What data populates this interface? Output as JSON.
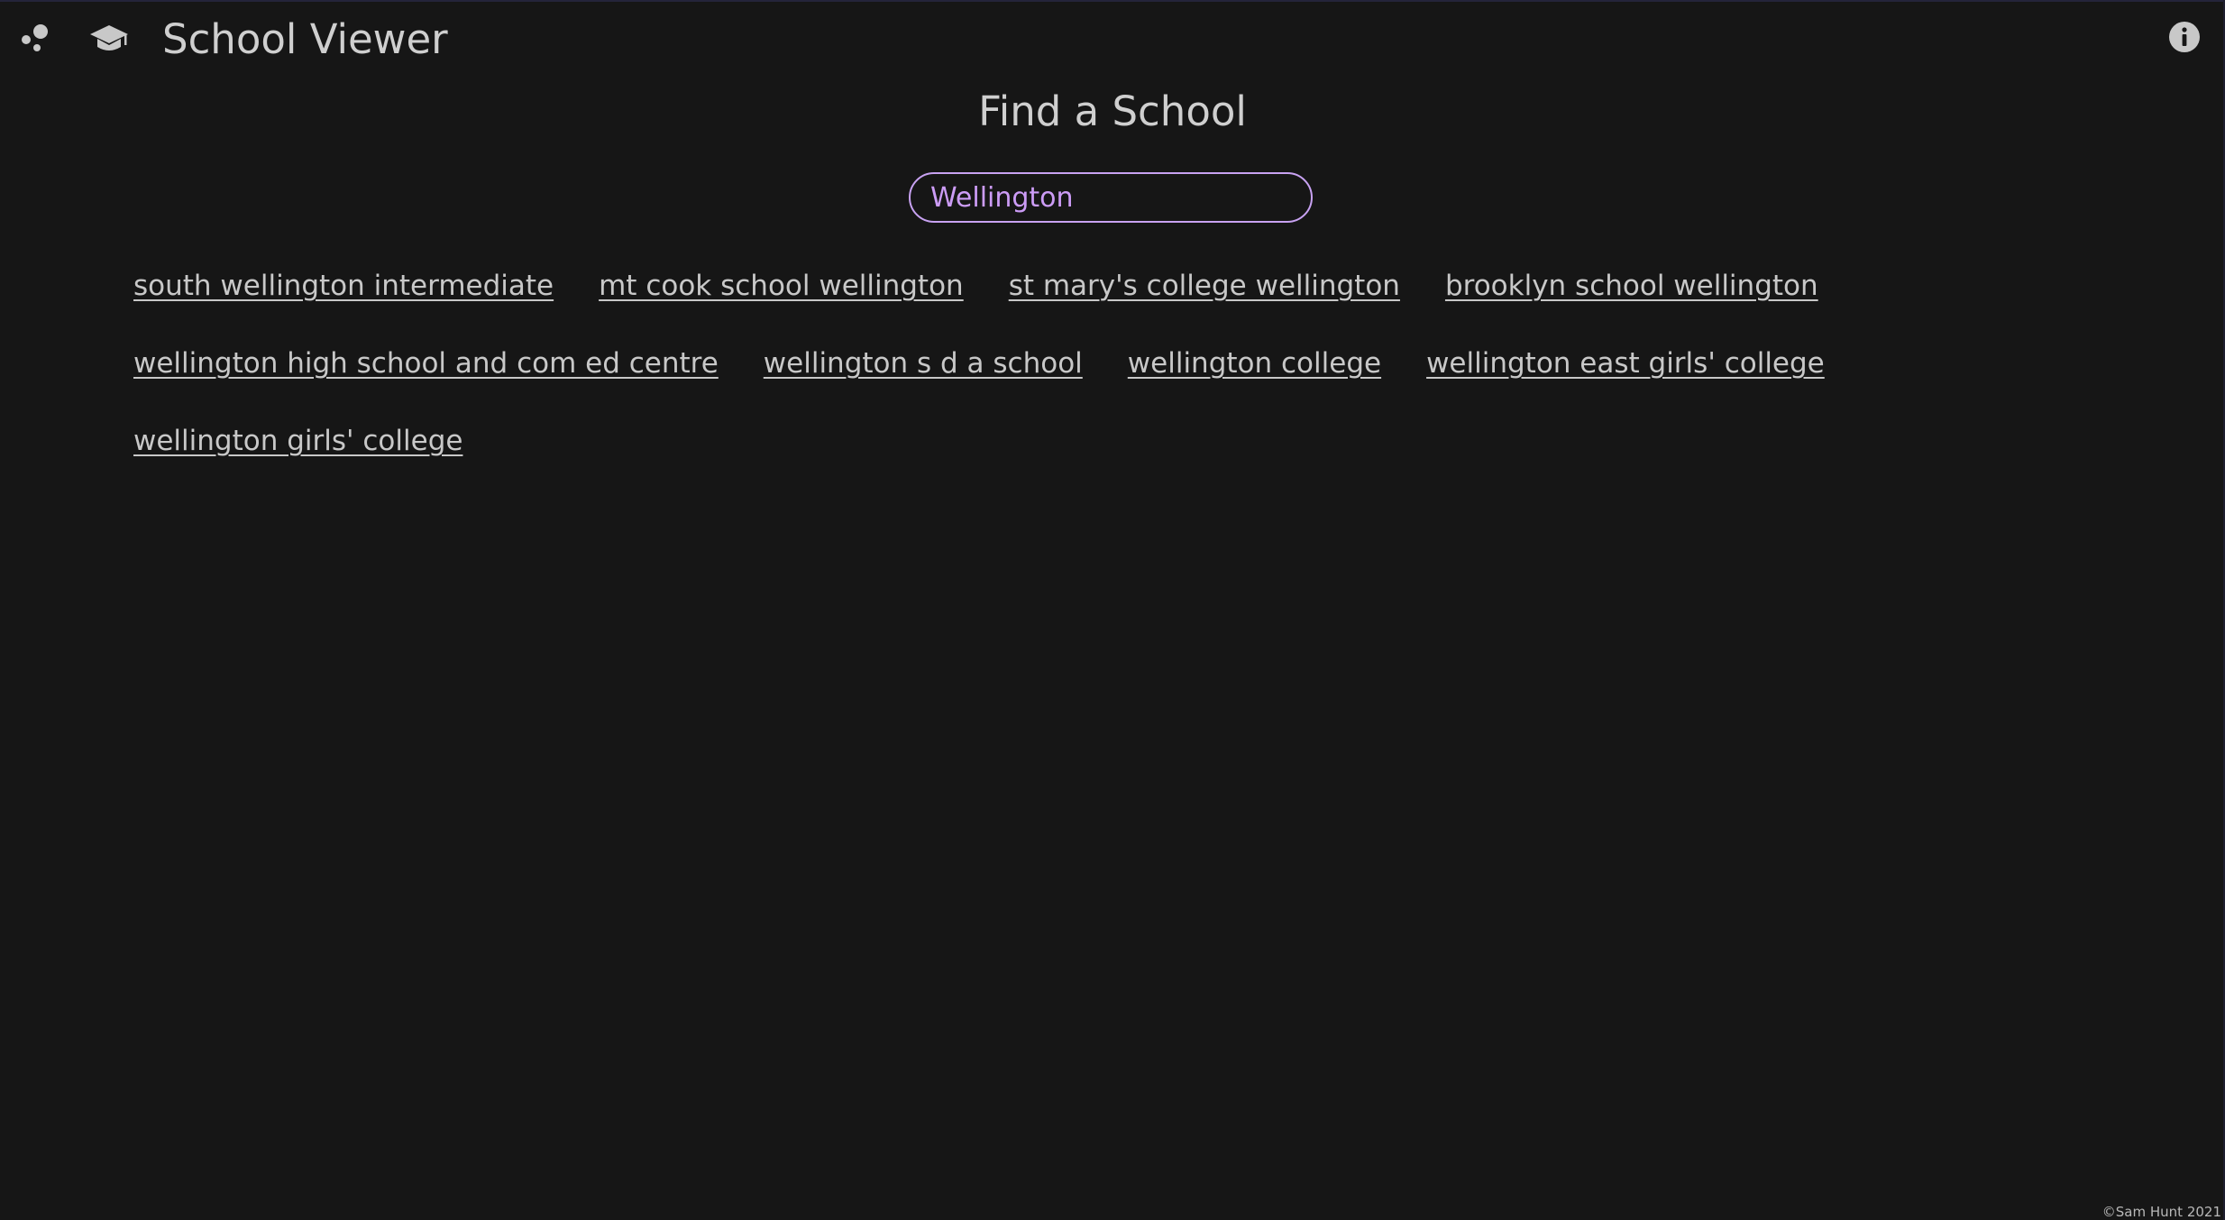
{
  "app": {
    "title": "School Viewer",
    "icons": {
      "menu": "app-logo-icon",
      "brand": "graduation-cap-icon",
      "info": "info-icon"
    }
  },
  "page": {
    "heading": "Find a School"
  },
  "search": {
    "value": "Wellington",
    "placeholder": ""
  },
  "results": [
    "south wellington intermediate",
    "mt cook school wellington",
    "st mary's college wellington",
    "brooklyn school wellington",
    "wellington high school and com ed centre",
    "wellington s d a school",
    "wellington college",
    "wellington east girls' college",
    "wellington girls' college"
  ],
  "footer": {
    "copyright": "©Sam Hunt 2021"
  },
  "colors": {
    "background": "#161616",
    "text": "#c8c8c8",
    "accent": "#c8a2f2"
  }
}
